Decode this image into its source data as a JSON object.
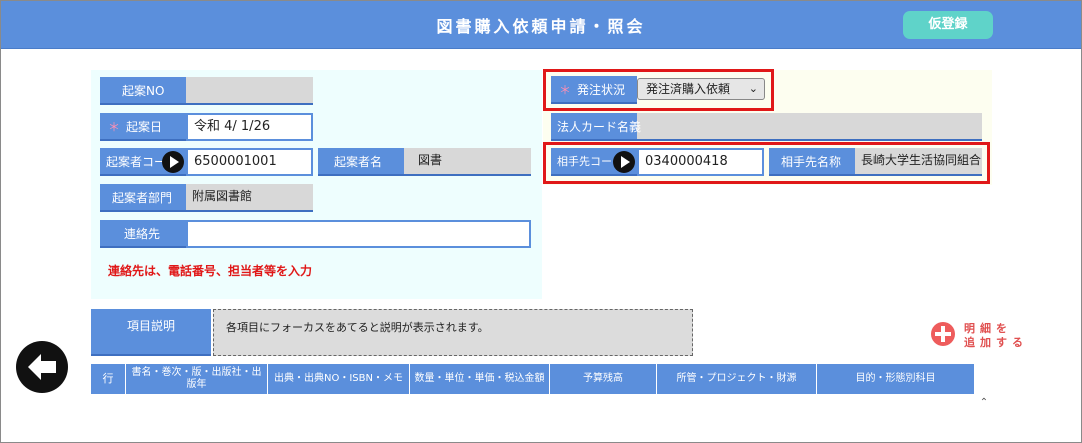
{
  "header": {
    "title": "図書購入依頼申請・照会",
    "temp_save_label": "仮登録"
  },
  "form_left": {
    "draft_no_label": "起案NO",
    "draft_no_value": "",
    "draft_date_label": "起案日",
    "draft_date_value": "令和 4/ 1/26",
    "drafter_code_label": "起案者コード",
    "drafter_code_value": "6500001001",
    "drafter_name_label": "起案者名",
    "drafter_name_value": "図書",
    "drafter_dept_label": "起案者部門",
    "drafter_dept_value": "附属図書館",
    "contact_label": "連絡先",
    "contact_value": "",
    "contact_note": "連絡先は、電話番号、担当者等を入力"
  },
  "form_right": {
    "order_status_label": "発注状況",
    "order_status_value": "発注済購入依頼",
    "corp_card_label": "法人カード名義",
    "partner_code_label": "相手先コード",
    "partner_code_value": "0340000418",
    "partner_name_label": "相手先名称",
    "partner_name_value": "長崎大学生活協同組合"
  },
  "help": {
    "label": "項目説明",
    "text": "各項目にフォーカスをあてると説明が表示されます。"
  },
  "add_detail": {
    "line1": "明細を",
    "line2": "追加する"
  },
  "grid": {
    "columns": [
      "行",
      "書名・巻次・版・出版社・出版年",
      "出典・出典NO・ISBN・メモ",
      "数量・単位・単価・税込金額",
      "予算残高",
      "所管・プロジェクト・財源",
      "目的・形態別科目"
    ]
  },
  "icons": {
    "back": "back-arrow-icon",
    "add": "plus-icon",
    "picker": "play-icon"
  },
  "colors": {
    "header": "#5b8fdc",
    "label": "#5b8fdc",
    "highlight": "#e01818",
    "temp_save": "#5fd3c9"
  }
}
